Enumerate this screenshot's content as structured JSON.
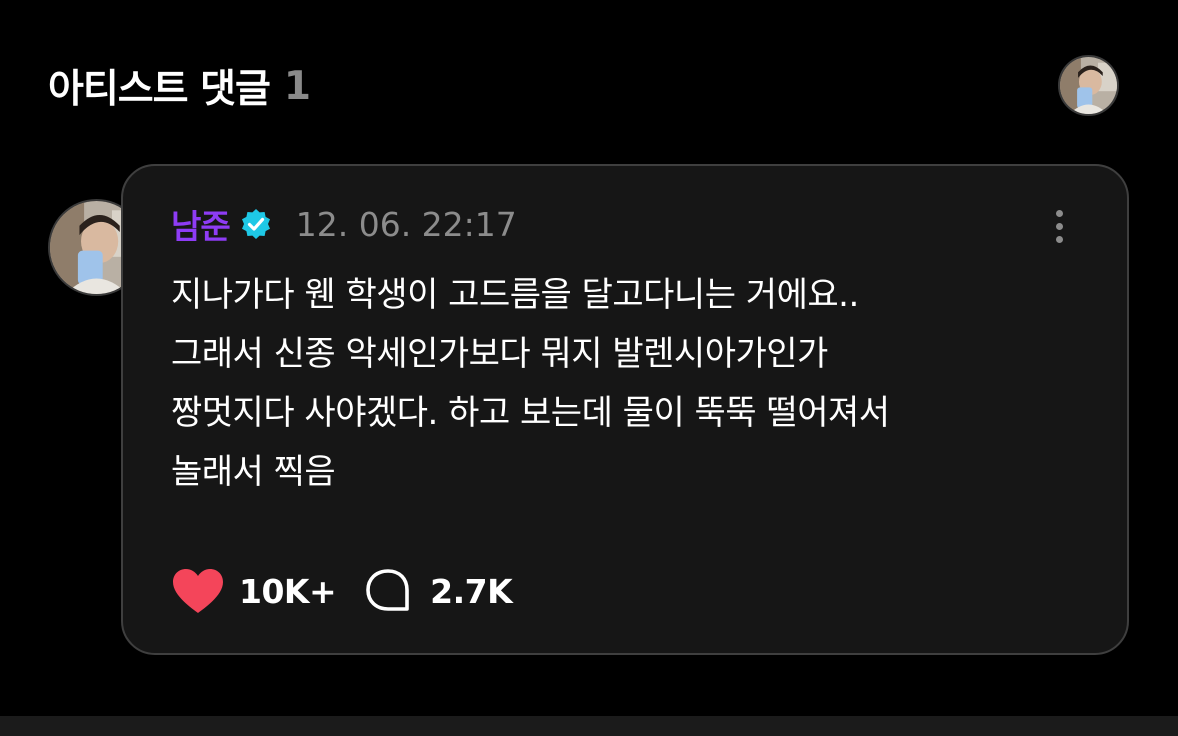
{
  "header": {
    "title": "아티스트 댓글",
    "count": "1"
  },
  "comment": {
    "author": "남준",
    "timestamp": "12. 06. 22:17",
    "body_lines": [
      "지나가다 웬 학생이 고드름을 달고다니는 거에요..",
      "그래서 신종 악세인가보다 뭐지 발렌시아가인가",
      "짱멋지다 사야겠다. 하고 보는데 물이 뚝뚝 떨어져서",
      "놀래서 찍음"
    ],
    "likes": "10K+",
    "replies": "2.7K"
  },
  "colors": {
    "background": "#000000",
    "card": "#161616",
    "author": "#8e3cf5",
    "verified": "#1ec8e6",
    "heart": "#f4455a",
    "muted": "#8c8c8c"
  },
  "icons": {
    "verified": "verified-badge-icon",
    "more": "more-vertical-icon",
    "like": "heart-icon",
    "reply": "comment-bubble-icon"
  }
}
